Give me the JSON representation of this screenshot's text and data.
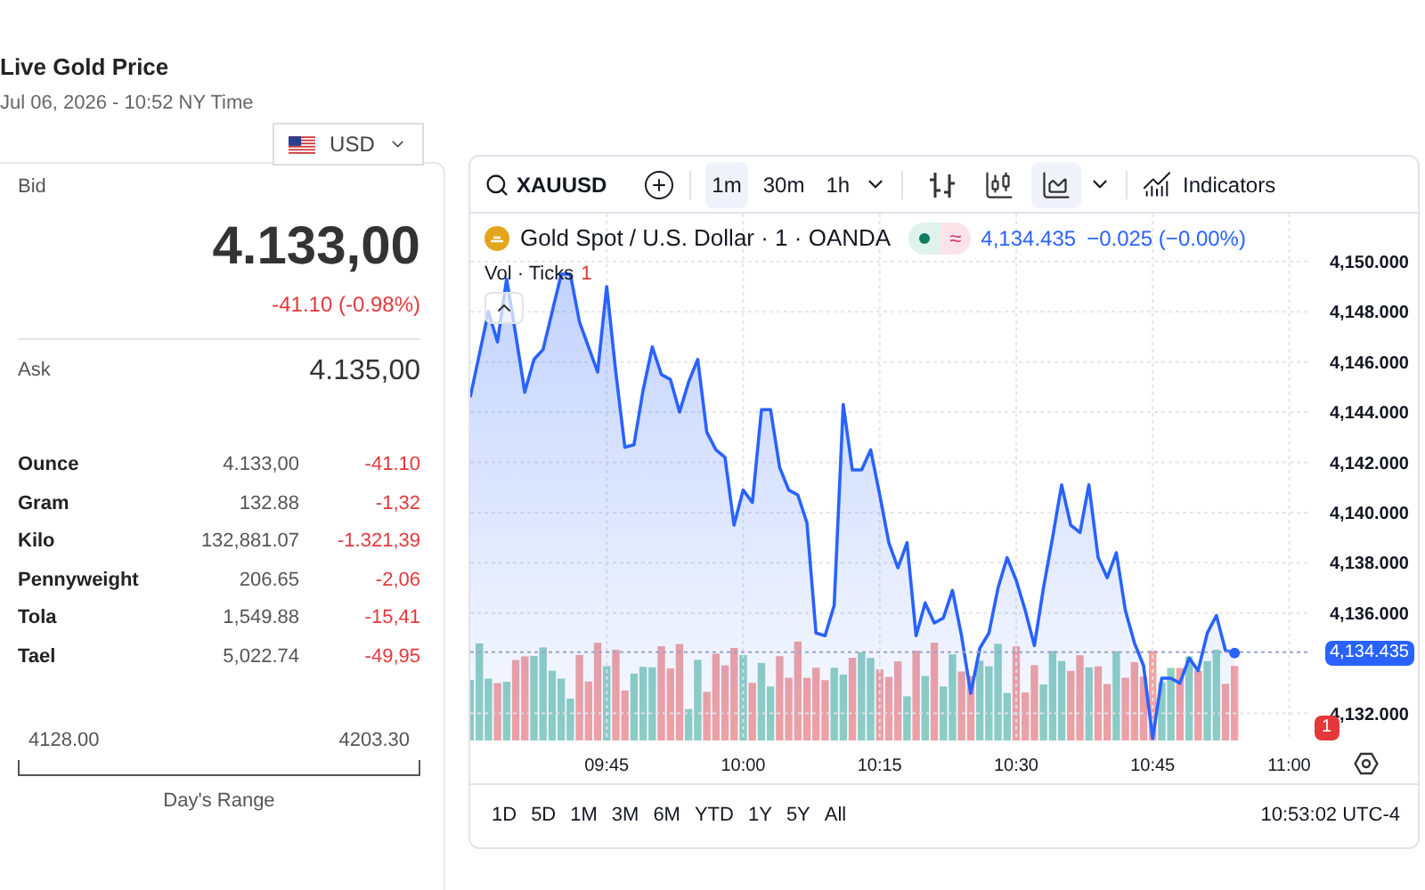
{
  "header": {
    "title": "Live Gold Price",
    "timestamp": "Jul 06, 2026 - 10:52 NY Time"
  },
  "currency": {
    "code": "USD"
  },
  "bid": {
    "label": "Bid",
    "price": "4.133,00",
    "change": "-41.10 (-0.98%)"
  },
  "ask": {
    "label": "Ask",
    "price": "4.135,00"
  },
  "units": [
    {
      "name": "Ounce",
      "price": "4.133,00",
      "change": "-41.10"
    },
    {
      "name": "Gram",
      "price": "132.88",
      "change": "-1,32"
    },
    {
      "name": "Kilo",
      "price": "132,881.07",
      "change": "-1.321,39"
    },
    {
      "name": "Pennyweight",
      "price": "206.65",
      "change": "-2,06"
    },
    {
      "name": "Tola",
      "price": "1,549.88",
      "change": "-15,41"
    },
    {
      "name": "Tael",
      "price": "5,022.74",
      "change": "-49,95"
    }
  ],
  "day_range": {
    "low": "4128.00",
    "high": "4203.30",
    "label": "Day's Range"
  },
  "chart": {
    "symbol": "XAUUSD",
    "intervals": [
      {
        "label": "1m",
        "selected": true
      },
      {
        "label": "30m",
        "selected": false
      },
      {
        "label": "1h",
        "selected": false
      }
    ],
    "styles": [
      {
        "kind": "bars",
        "selected": false
      },
      {
        "kind": "candles",
        "selected": false
      },
      {
        "kind": "area",
        "selected": true
      }
    ],
    "indicators_label": "Indicators",
    "legend": {
      "title": "Gold Spot / U.S. Dollar · 1 · OANDA",
      "flag": "≈",
      "last": "4,134.435",
      "change": "−0.025 (−0.00%)"
    },
    "volume_label": "Vol · Ticks",
    "volume_badge": "1",
    "price_label": "4,134.435",
    "alert_badge": "1",
    "chart_data": {
      "type": "area",
      "x": [
        9.5,
        9.5167,
        9.5333,
        9.55,
        9.5667,
        9.5833,
        9.6,
        9.6167,
        9.6333,
        9.65,
        9.6667,
        9.6833,
        9.7,
        9.7167,
        9.7333,
        9.75,
        9.7667,
        9.7833,
        9.8,
        9.8167,
        9.8333,
        9.85,
        9.8667,
        9.8833,
        9.9,
        9.9167,
        9.9333,
        9.95,
        9.9667,
        9.9833,
        10,
        10.0167,
        10.0333,
        10.05,
        10.0667,
        10.0833,
        10.1,
        10.1167,
        10.1333,
        10.15,
        10.1667,
        10.1833,
        10.2,
        10.2167,
        10.2333,
        10.25,
        10.2667,
        10.2833,
        10.3,
        10.3167,
        10.3333,
        10.35,
        10.3667,
        10.3833,
        10.4,
        10.4167,
        10.4333,
        10.45,
        10.4667,
        10.4833,
        10.5,
        10.5167,
        10.5333,
        10.55,
        10.5667,
        10.5833,
        10.6,
        10.6167,
        10.6333,
        10.65,
        10.6667,
        10.6833,
        10.7,
        10.7167,
        10.7333,
        10.75,
        10.7667,
        10.7833,
        10.8,
        10.8167,
        10.8333,
        10.85,
        10.8667,
        10.8833,
        10.9
      ],
      "series": [
        {
          "color": "#2962ff",
          "values": [
            4144.6,
            4146.3,
            4148.0,
            4146.8,
            4149.3,
            4147.1,
            4144.8,
            4146.1,
            4146.5,
            4148.0,
            4149.5,
            4149.5,
            4147.6,
            4146.6,
            4145.6,
            4149.0,
            4145.6,
            4142.6,
            4142.7,
            4144.9,
            4146.6,
            4145.5,
            4145.3,
            4144.0,
            4145.2,
            4146.1,
            4143.2,
            4142.5,
            4142.2,
            4139.5,
            4140.9,
            4140.4,
            4144.1,
            4144.1,
            4141.8,
            4140.9,
            4140.7,
            4139.6,
            4135.2,
            4135.1,
            4136.3,
            4144.3,
            4141.7,
            4141.7,
            4142.5,
            4140.7,
            4138.8,
            4137.8,
            4138.8,
            4135.1,
            4136.4,
            4135.6,
            4135.8,
            4136.9,
            4135.1,
            4132.8,
            4134.6,
            4135.2,
            4137.0,
            4138.2,
            4137.3,
            4136.1,
            4134.7,
            4137.0,
            4139.0,
            4141.1,
            4139.5,
            4139.2,
            4141.1,
            4138.2,
            4137.4,
            4138.4,
            4136.1,
            4134.8,
            4133.9,
            4131.0,
            4133.4,
            4133.4,
            4133.2,
            4134.2,
            4133.7,
            4135.2,
            4135.9,
            4134.5,
            4134.4
          ]
        }
      ],
      "grid": true,
      "ref_lines": [
        {
          "axis": "y",
          "value": 4134.435
        }
      ],
      "xlim": [
        9.5,
        11.04
      ],
      "ylim": [
        4130.92,
        4151.91
      ],
      "xticks": [
        {
          "value": 9.75,
          "label": "09:45"
        },
        {
          "value": 10,
          "label": "10:00"
        },
        {
          "value": 10.25,
          "label": "10:15"
        },
        {
          "value": 10.5,
          "label": "10:30"
        },
        {
          "value": 10.75,
          "label": "10:45"
        },
        {
          "value": 11,
          "label": "11:00"
        }
      ],
      "yticks": [
        {
          "value": 4132,
          "label": "4,132.000"
        },
        {
          "value": 4136,
          "label": "4,136.000"
        },
        {
          "value": 4138,
          "label": "4,138.000"
        },
        {
          "value": 4140,
          "label": "4,140.000"
        },
        {
          "value": 4142,
          "label": "4,142.000"
        },
        {
          "value": 4144,
          "label": "4,144.000"
        },
        {
          "value": 4146,
          "label": "4,146.000"
        },
        {
          "value": 4148,
          "label": "4,148.000"
        },
        {
          "value": 4150,
          "label": "4,150.000"
        }
      ]
    },
    "ranges": [
      "1D",
      "5D",
      "1M",
      "3M",
      "6M",
      "YTD",
      "1Y",
      "5Y",
      "All"
    ],
    "clock": "10:53:02 UTC-4"
  }
}
